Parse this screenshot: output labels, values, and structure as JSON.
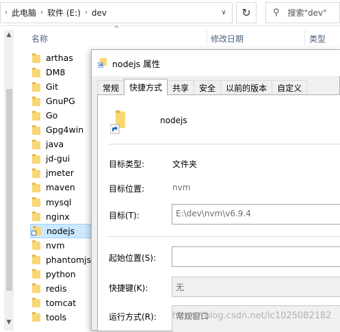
{
  "address": {
    "crumbs": [
      "此电脑",
      "软件 (E:)",
      "dev"
    ],
    "search_placeholder": "搜索\"dev\""
  },
  "columns": {
    "name": "名称",
    "modified": "修改日期",
    "type": "类型"
  },
  "files": [
    {
      "name": "arthas",
      "icon": "folder"
    },
    {
      "name": "DM8",
      "icon": "folder"
    },
    {
      "name": "Git",
      "icon": "folder"
    },
    {
      "name": "GnuPG",
      "icon": "folder"
    },
    {
      "name": "Go",
      "icon": "folder"
    },
    {
      "name": "Gpg4win",
      "icon": "folder"
    },
    {
      "name": "java",
      "icon": "folder"
    },
    {
      "name": "jd-gui",
      "icon": "folder"
    },
    {
      "name": "jmeter",
      "icon": "folder"
    },
    {
      "name": "maven",
      "icon": "folder"
    },
    {
      "name": "mysql",
      "icon": "folder"
    },
    {
      "name": "nginx",
      "icon": "folder"
    },
    {
      "name": "nodejs",
      "icon": "folder-shortcut",
      "selected": true
    },
    {
      "name": "nvm",
      "icon": "folder"
    },
    {
      "name": "phantomjs",
      "icon": "folder"
    },
    {
      "name": "python",
      "icon": "folder"
    },
    {
      "name": "redis",
      "icon": "folder"
    },
    {
      "name": "tomcat",
      "icon": "folder"
    },
    {
      "name": "tools",
      "icon": "folder"
    }
  ],
  "dialog": {
    "title": "nodejs 属性",
    "tabs": [
      "常规",
      "快捷方式",
      "共享",
      "安全",
      "以前的版本",
      "自定义"
    ],
    "active_tab": "快捷方式",
    "shortcut_name": "nodejs",
    "target_type_label": "目标类型:",
    "target_type_value": "文件夹",
    "target_location_label": "目标位置:",
    "target_location_value": "nvm",
    "target_label": "目标(T):",
    "target_value": "E:\\dev\\nvm\\v6.9.4",
    "start_in_label": "起始位置(S):",
    "start_in_value": "",
    "hotkey_label": "快捷键(K):",
    "hotkey_value": "无",
    "run_label": "运行方式(R):",
    "run_value": "常规窗口"
  },
  "watermark": "https://blog.csdn.net/lc1025082182",
  "colors": {
    "selection_bg": "#cce8ff",
    "selection_border": "#99d1ff",
    "folder": "#f8d775"
  }
}
